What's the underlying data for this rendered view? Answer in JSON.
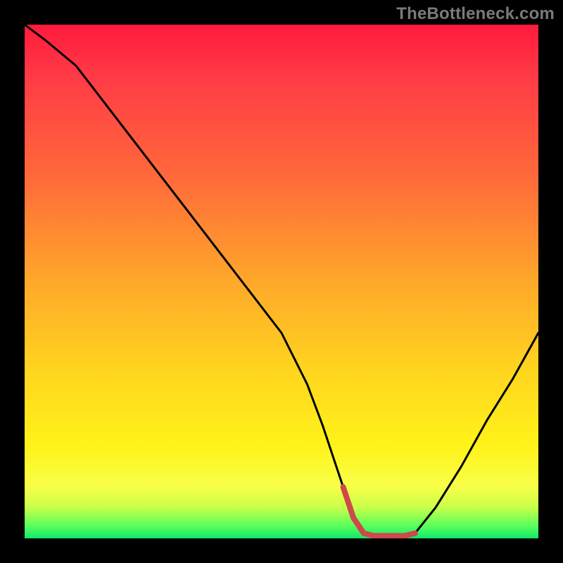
{
  "watermark": "TheBottleneck.com",
  "chart_data": {
    "type": "line",
    "title": "",
    "xlabel": "",
    "ylabel": "",
    "xlim": [
      0,
      100
    ],
    "ylim": [
      0,
      100
    ],
    "x": [
      0,
      4,
      10,
      20,
      30,
      40,
      50,
      55,
      58,
      62,
      64,
      66,
      68,
      70,
      72,
      74,
      76,
      80,
      85,
      90,
      95,
      100
    ],
    "values": [
      100,
      97,
      92,
      79,
      66,
      53,
      40,
      30,
      22,
      10,
      4,
      1,
      0.5,
      0.5,
      0.5,
      0.5,
      1,
      6,
      14,
      23,
      31,
      40
    ],
    "optimal_range_x": [
      62,
      76
    ],
    "series": [
      {
        "name": "bottleneck-curve",
        "color": "#000000"
      },
      {
        "name": "optimal-zone",
        "color": "#cc4a4a"
      }
    ]
  }
}
